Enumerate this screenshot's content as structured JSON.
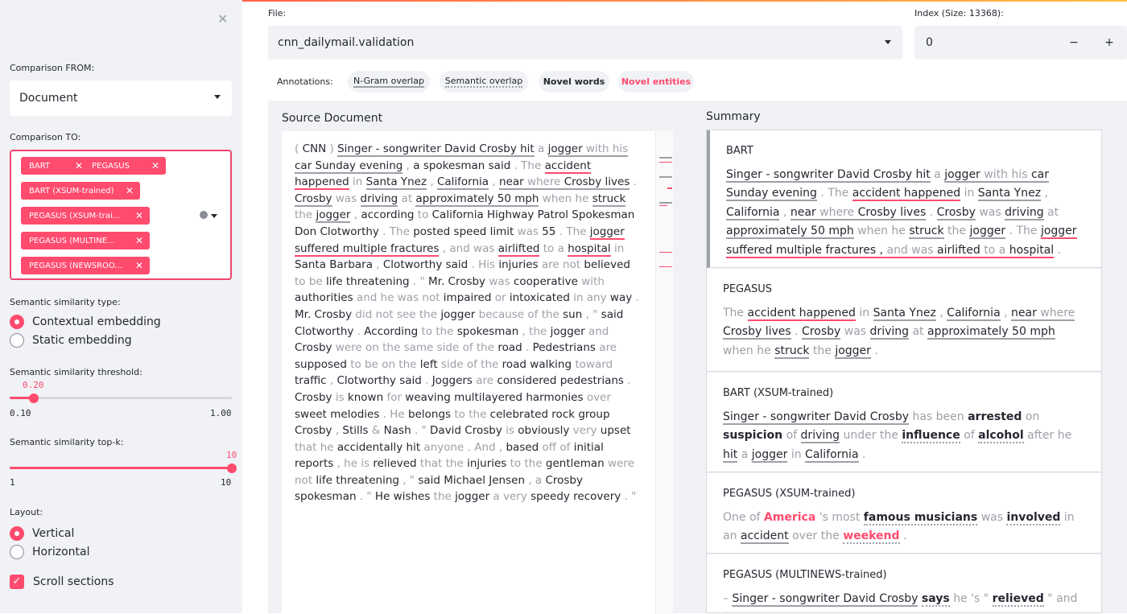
{
  "sidebar": {
    "close_icon": "close-icon",
    "comparison_from_label": "Comparison FROM:",
    "comparison_from_value": "Document",
    "comparison_to_label": "Comparison TO:",
    "comparison_to_tags": [
      "BART",
      "PEGASUS",
      "BART (XSUM-trained)",
      "PEGASUS (XSUM-trai...",
      "PEGASUS (MULTINE...",
      "PEGASUS (NEWSROO..."
    ],
    "semantic_type_label": "Semantic similarity type:",
    "semantic_type_options": [
      "Contextual embedding",
      "Static embedding"
    ],
    "threshold_label": "Semantic similarity threshold:",
    "threshold_value": "0.20",
    "threshold_fraction": 0.111,
    "threshold_min": "0.10",
    "threshold_max": "1.00",
    "topk_label": "Semantic similarity top-k:",
    "topk_value": "10",
    "topk_min": "1",
    "topk_max": "10",
    "layout_label": "Layout:",
    "layout_options": [
      "Vertical",
      "Horizontal"
    ],
    "scroll_label": "Scroll sections",
    "accent": "#ff4b6e"
  },
  "header": {
    "file_label": "File:",
    "file_value": "cnn_dailymail.validation",
    "index_label": "Index (Size: 13368):",
    "index_value": "0",
    "minus": "−",
    "plus": "+"
  },
  "annotations": {
    "label": "Annotations:",
    "items": [
      "N-Gram overlap",
      "Semantic overlap",
      "Novel words",
      "Novel entities"
    ]
  },
  "source": {
    "title": "Source Document"
  },
  "summary": {
    "title": "Summary",
    "cards": [
      "BART",
      "PEGASUS",
      "BART (XSUM-trained)",
      "PEGASUS (XSUM-trained)",
      "PEGASUS (MULTINEWS-trained)"
    ]
  }
}
